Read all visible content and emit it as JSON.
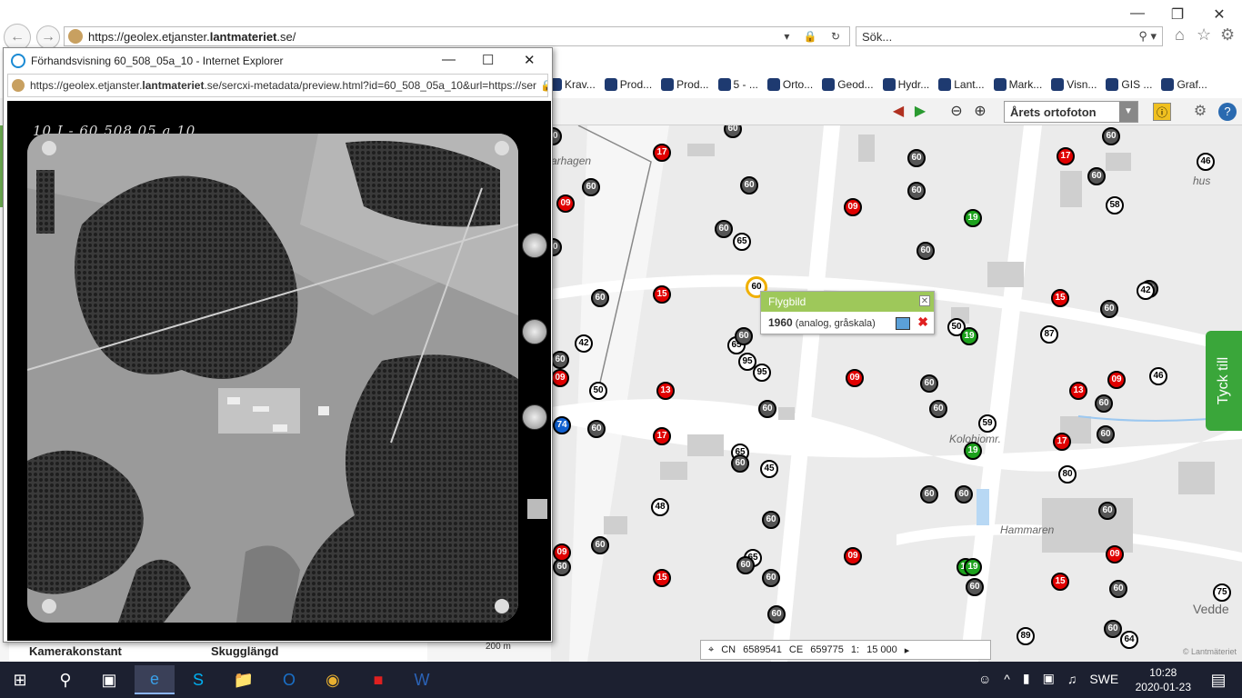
{
  "browser": {
    "url_prefix": "https://geolex.etjanster.",
    "url_host": "lantmateriet",
    "url_suffix": ".se/",
    "search_placeholder": "Sök...",
    "favorites": [
      {
        "label": "Krav...",
        "icon": "link-icon"
      },
      {
        "label": "Prod...",
        "icon": "lantmateriet-icon"
      },
      {
        "label": "Prod...",
        "icon": "lantmateriet-icon"
      },
      {
        "label": "5 - ...",
        "icon": "lantmateriet-icon"
      },
      {
        "label": "Orto...",
        "icon": "lantmateriet-icon"
      },
      {
        "label": "Geod...",
        "icon": "page-icon"
      },
      {
        "label": "Hydr...",
        "icon": "lantmateriet-icon"
      },
      {
        "label": "Lant...",
        "icon": "page-icon"
      },
      {
        "label": "Mark...",
        "icon": "lantmateriet-icon"
      },
      {
        "label": "Visn...",
        "icon": "lantmateriet-icon"
      },
      {
        "label": "GIS ...",
        "icon": "gis-icon"
      },
      {
        "label": "Graf...",
        "icon": "graf-icon"
      }
    ]
  },
  "map": {
    "layer_select": "Årets ortofoton",
    "labels": [
      {
        "text": "arhagen"
      },
      {
        "text": "hus"
      },
      {
        "text": "Kolohiomr."
      },
      {
        "text": "Hammaren"
      },
      {
        "text": "Vedde"
      }
    ],
    "popup": {
      "title": "Flygbild",
      "year": "1960",
      "detail": "(analog, gråskala)"
    },
    "feedback": "Tyck till",
    "coords": {
      "cn_label": "CN",
      "cn": "6589541",
      "ce_label": "CE",
      "ce": "659775",
      "scale_label": "1:",
      "scale": "15 000"
    },
    "copyright": "© Lantmäteriet",
    "scale_bar": "200 m",
    "markers": [
      {
        "t": "60",
        "c": "gray"
      },
      {
        "t": "17",
        "c": "red"
      },
      {
        "t": "60",
        "c": "gray"
      },
      {
        "t": "60",
        "c": "gray"
      },
      {
        "t": "17",
        "c": "red"
      },
      {
        "t": "60",
        "c": "gray"
      },
      {
        "t": "46",
        "c": "white"
      },
      {
        "t": "09",
        "c": "red"
      },
      {
        "t": "60",
        "c": "gray"
      },
      {
        "t": "60",
        "c": "gray"
      },
      {
        "t": "60",
        "c": "gray"
      },
      {
        "t": "09",
        "c": "red"
      },
      {
        "t": "60",
        "c": "gray"
      },
      {
        "t": "19",
        "c": "green"
      },
      {
        "t": "58",
        "c": "white"
      },
      {
        "t": "60",
        "c": "gray"
      },
      {
        "t": "65",
        "c": "white"
      },
      {
        "t": "60",
        "c": "gray"
      },
      {
        "t": "60",
        "c": "gray"
      },
      {
        "t": "60",
        "c": "gray"
      },
      {
        "t": "42",
        "c": "white"
      },
      {
        "t": "60",
        "c": "gray"
      },
      {
        "t": "15",
        "c": "red"
      },
      {
        "t": "15",
        "c": "red"
      },
      {
        "t": "60",
        "c": "gray"
      },
      {
        "t": "50",
        "c": "white"
      },
      {
        "t": "19",
        "c": "green"
      },
      {
        "t": "87",
        "c": "white"
      },
      {
        "t": "42",
        "c": "white"
      },
      {
        "t": "65",
        "c": "white"
      },
      {
        "t": "60",
        "c": "gray"
      },
      {
        "t": "95",
        "c": "white"
      },
      {
        "t": "95",
        "c": "white"
      },
      {
        "t": "60",
        "c": "gray"
      },
      {
        "t": "09",
        "c": "red"
      },
      {
        "t": "09",
        "c": "red"
      },
      {
        "t": "13",
        "c": "red"
      },
      {
        "t": "09",
        "c": "red"
      },
      {
        "t": "60",
        "c": "gray"
      },
      {
        "t": "13",
        "c": "red"
      },
      {
        "t": "46",
        "c": "white"
      },
      {
        "t": "50",
        "c": "white"
      },
      {
        "t": "60",
        "c": "gray"
      },
      {
        "t": "60",
        "c": "gray"
      },
      {
        "t": "60",
        "c": "gray"
      },
      {
        "t": "74",
        "c": "blue"
      },
      {
        "t": "60",
        "c": "gray"
      },
      {
        "t": "17",
        "c": "red"
      },
      {
        "t": "59",
        "c": "white"
      },
      {
        "t": "60",
        "c": "gray"
      },
      {
        "t": "17",
        "c": "red"
      },
      {
        "t": "65",
        "c": "white"
      },
      {
        "t": "60",
        "c": "gray"
      },
      {
        "t": "45",
        "c": "white"
      },
      {
        "t": "19",
        "c": "green"
      },
      {
        "t": "80",
        "c": "white"
      },
      {
        "t": "48",
        "c": "white"
      },
      {
        "t": "60",
        "c": "gray"
      },
      {
        "t": "60",
        "c": "gray"
      },
      {
        "t": "60",
        "c": "gray"
      },
      {
        "t": "60",
        "c": "gray"
      },
      {
        "t": "60",
        "c": "gray"
      },
      {
        "t": "09",
        "c": "red"
      },
      {
        "t": "60",
        "c": "gray"
      },
      {
        "t": "60",
        "c": "gray"
      },
      {
        "t": "65",
        "c": "white"
      },
      {
        "t": "09",
        "c": "red"
      },
      {
        "t": "09",
        "c": "red"
      },
      {
        "t": "15",
        "c": "red"
      },
      {
        "t": "60",
        "c": "gray"
      },
      {
        "t": "19",
        "c": "green"
      },
      {
        "t": "19",
        "c": "green"
      },
      {
        "t": "60",
        "c": "gray"
      },
      {
        "t": "15",
        "c": "red"
      },
      {
        "t": "60",
        "c": "gray"
      },
      {
        "t": "75",
        "c": "white"
      },
      {
        "t": "60",
        "c": "gray"
      },
      {
        "t": "89",
        "c": "white"
      },
      {
        "t": "60",
        "c": "gray"
      },
      {
        "t": "64",
        "c": "white"
      },
      {
        "t": "60",
        "c": "yellow"
      }
    ]
  },
  "left_panel": {
    "kamerakonstant": "Kamerakonstant",
    "skugglangd": "Skugglängd"
  },
  "preview": {
    "title": "Förhandsvisning 60_508_05a_10 - Internet Explorer",
    "url_prefix": "https://geolex.etjanster.",
    "url_host": "lantmateriet",
    "url_suffix": ".se/sercxi-metadata/preview.html?id=60_508_05a_10&url=https://ser",
    "photo_caption": "10 I - 60 508 05 a 10"
  },
  "taskbar": {
    "lang": "SWE",
    "time": "10:28",
    "date": "2020-01-23"
  }
}
